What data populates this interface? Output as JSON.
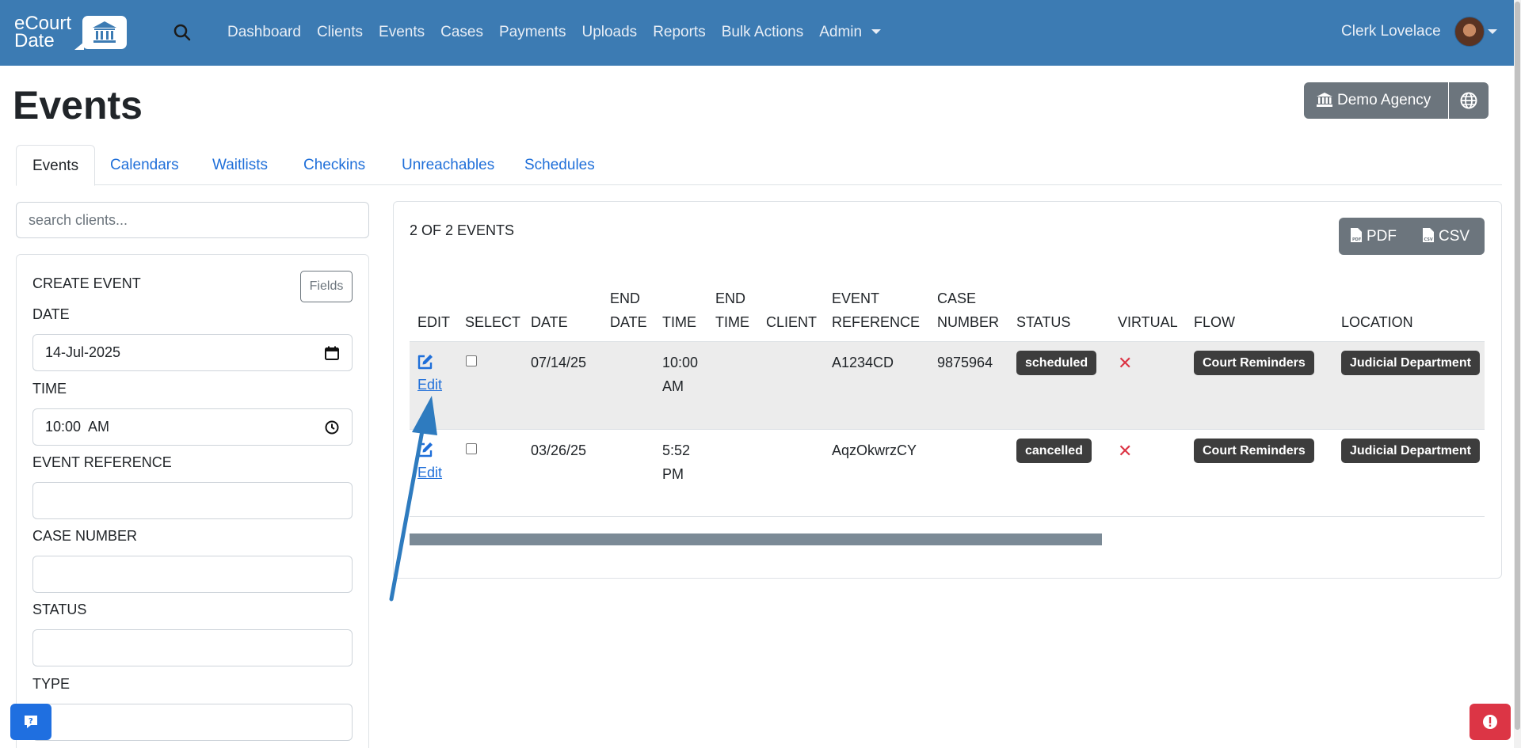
{
  "brand": {
    "line1": "eCourt",
    "line2": "Date"
  },
  "nav": {
    "items": [
      "Dashboard",
      "Clients",
      "Events",
      "Cases",
      "Payments",
      "Uploads",
      "Reports",
      "Bulk Actions",
      "Admin"
    ],
    "user": "Clerk Lovelace"
  },
  "header": {
    "title": "Events",
    "agency": "Demo Agency"
  },
  "tabs": [
    "Events",
    "Calendars",
    "Waitlists",
    "Checkins",
    "Unreachables",
    "Schedules"
  ],
  "search": {
    "placeholder": "search clients..."
  },
  "create_form": {
    "title": "CREATE EVENT",
    "fields_button": "Fields",
    "labels": [
      "DATE",
      "TIME",
      "EVENT REFERENCE",
      "CASE NUMBER",
      "STATUS",
      "TYPE"
    ],
    "date_value": "14-Jul-2025",
    "time_value": "10:00  AM"
  },
  "events": {
    "count_label": "2 OF 2 EVENTS",
    "pdf_label": "PDF",
    "csv_label": "CSV",
    "headers": {
      "edit": "EDIT",
      "select": "SELECT",
      "date": "DATE",
      "end_date_1": "END",
      "end_date_2": "DATE",
      "time": "TIME",
      "end_time_1": "END",
      "end_time_2": "TIME",
      "client": "CLIENT",
      "event_ref_1": "EVENT",
      "event_ref_2": "REFERENCE",
      "case_num_1": "CASE",
      "case_num_2": "NUMBER",
      "status": "STATUS",
      "virtual": "VIRTUAL",
      "flow": "FLOW",
      "location": "LOCATION"
    },
    "rows": [
      {
        "edit": "Edit",
        "date": "07/14/25",
        "time_1": "10:00",
        "time_2": "AM",
        "reference": "A1234CD",
        "case_number": "9875964",
        "status": "scheduled",
        "virtual": "✕",
        "flow": "Court Reminders",
        "location": "Judicial Department"
      },
      {
        "edit": "Edit",
        "date": "03/26/25",
        "time_1": "5:52",
        "time_2": "PM",
        "reference": "AqzOkwrzCY",
        "case_number": "",
        "status": "cancelled",
        "virtual": "✕",
        "flow": "Court Reminders",
        "location": "Judicial Department"
      }
    ]
  },
  "colors": {
    "navbar": "#3c7bb3",
    "link": "#1f6fd9",
    "badge": "#3d3d3d",
    "danger": "#dc3545",
    "arrow": "#2e7bbf"
  }
}
